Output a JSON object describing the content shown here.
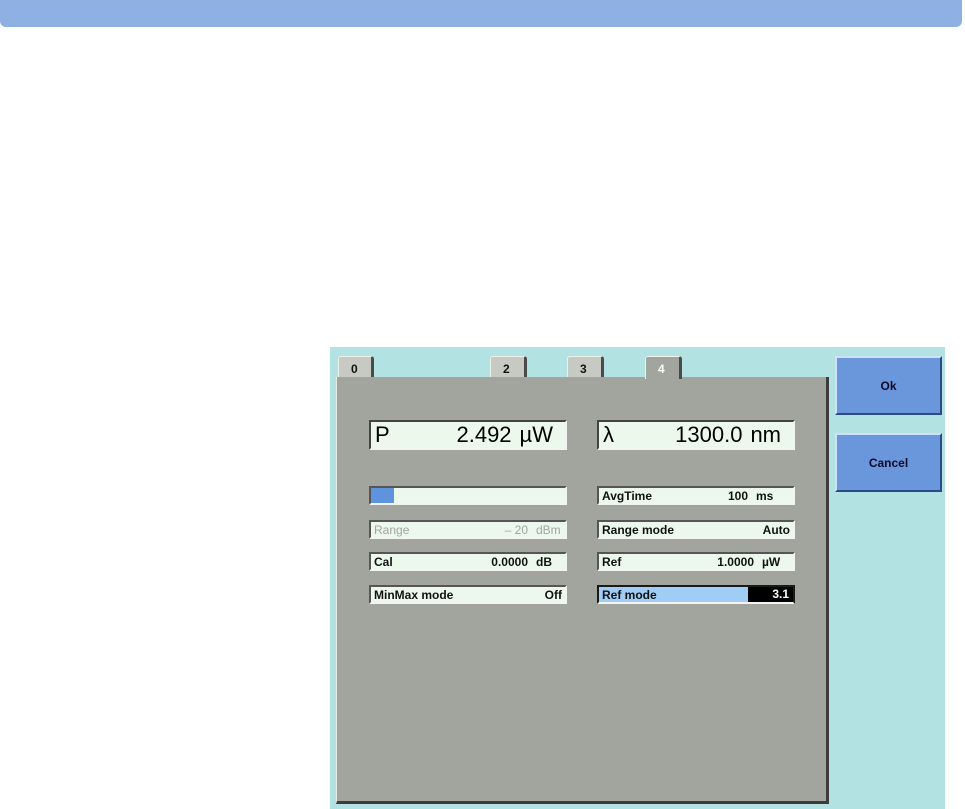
{
  "tabs": [
    {
      "label": "0",
      "active": false
    },
    {
      "label": "2",
      "active": false
    },
    {
      "label": "3",
      "active": false
    },
    {
      "label": "4",
      "active": true
    }
  ],
  "power": {
    "symbol": "P",
    "value": "2.492",
    "unit": "µW"
  },
  "wavelength": {
    "symbol": "λ",
    "value": "1300.0",
    "unit": "nm"
  },
  "signal_level": 0.12,
  "range": {
    "label": "Range",
    "value": "– 20",
    "unit": "dBm"
  },
  "cal": {
    "label": "Cal",
    "value": "0.0000",
    "unit": "dB"
  },
  "minmax": {
    "label": "MinMax mode",
    "value": "Off"
  },
  "avgtime": {
    "label": "AvgTime",
    "value": "100",
    "unit": "ms"
  },
  "range_mode": {
    "label": "Range mode",
    "value": "Auto"
  },
  "ref": {
    "label": "Ref",
    "value": "1.0000",
    "unit": "µW"
  },
  "ref_mode": {
    "label": "Ref mode",
    "value": "3.1"
  },
  "buttons": {
    "ok": "Ok",
    "cancel": "Cancel"
  },
  "colors": {
    "title_bar": "#8eb0e3",
    "panel": "#b3e2e2",
    "content": "#a2a59e",
    "field": "#ecf8ec",
    "selected": "#9fcdf5",
    "button": "#6a97dc"
  }
}
